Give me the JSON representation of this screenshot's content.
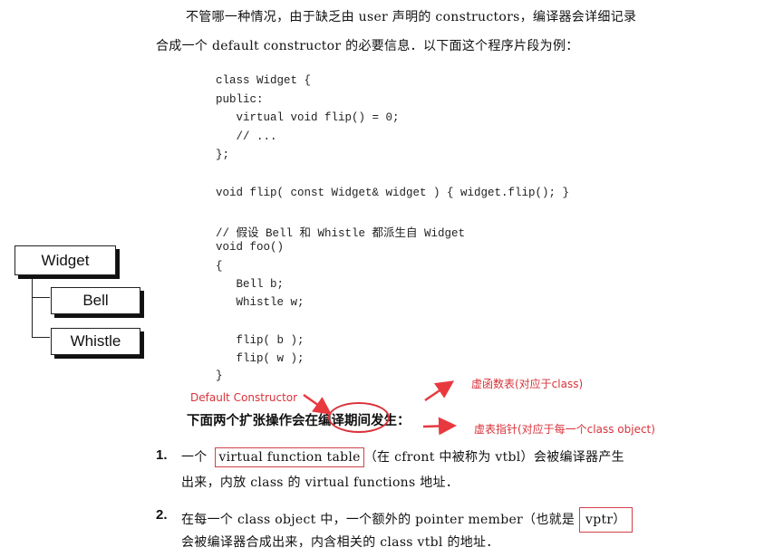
{
  "page": {
    "intro": {
      "line1": "不管哪一种情况，由于缺乏由 user 声明的 constructors，编译器会详细记录",
      "line2": "合成一个 default constructor 的必要信息．以下面这个程序片段为例："
    },
    "code": [
      "class Widget {",
      "public:",
      "   virtual void flip() = 0;",
      "   // ...",
      "};",
      "",
      "void flip( const Widget& widget ) { widget.flip(); }",
      "",
      "// 假设 Bell 和 Whistle 都派生自 Widget",
      "void foo()",
      "{",
      "   Bell b;",
      "   Whistle w;",
      "",
      "   flip( b );",
      "   flip( w );",
      "}"
    ],
    "diagram": {
      "root": "Widget",
      "children": [
        "Bell",
        "Whistle"
      ]
    },
    "expansion_heading": {
      "before": "下面两个扩张操作会在",
      "circled": "编译期间",
      "after": "发生："
    },
    "annotations": {
      "default_constructor": "Default Constructor",
      "vtbl_note": "虚函数表(对应于class)",
      "vptr_note": "虚表指针(对应于每一个class object)",
      "color": "#d9323a"
    },
    "items": [
      {
        "number": "1.",
        "prefix": "一个",
        "boxed": "virtual function table",
        "rest_line1": "（在 cfront 中被称为 vtbl）会被编译器产生",
        "line2": "出来，内放 class 的 virtual functions 地址．"
      },
      {
        "number": "2.",
        "line1": "在每一个 class object 中，一个额外的 pointer member（也就是",
        "boxed": "vptr）",
        "line2": "会被编译器合成出来，内含相关的 class vtbl 的地址．"
      }
    ]
  }
}
